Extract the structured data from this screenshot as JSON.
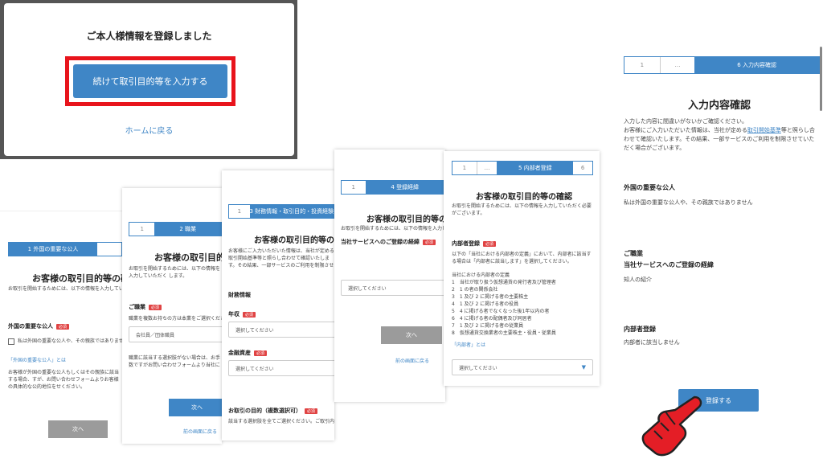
{
  "dialog": {
    "title": "ご本人様情報を登録しました",
    "continue_button": "続けて取引目的等を入力する",
    "home_link": "ホームに戻る"
  },
  "p1": {
    "step_active": "1 外国の重要な公人",
    "title": "お客様の取引目的等の確認",
    "intro": "お取引を開始するためには、以下の情報を入力していただく",
    "pep_label": "外国の重要な公人",
    "checkbox_label": "私は外国の重要な公人や、その親族ではありません",
    "pep_link": "「外国の重要な公人」とは",
    "note": "お客様が外国の重要な公人もしくはその親族に該当する場合、すが、お問い合わせフォームよりお客様の具体的な公的地位をせください。",
    "next_button": "次へ"
  },
  "p2": {
    "step_1": "1",
    "step_active": "2 職業",
    "title": "お客様の取引目的",
    "intro": "お取引を開始するためには、以下の情報を入力していただく します。",
    "occupation_label": "ご職業",
    "occupation_hint": "職業を複数お持ちの方は本業をご選択ください。",
    "occupation_value": "会社員／団体職員",
    "note": "職業に該当する選択肢がない場合は、お手数ですがお問い合わせフォームより当社にお知らせください。",
    "next_button": "次へ",
    "back_link": "前の画面に戻る"
  },
  "p3": {
    "step_1": "1",
    "step_active": "3 財務情報・取引目的・投資経験",
    "title": "お客様の取引目的等の確",
    "intro": "お客様にご入力いただいた情報は、当社が定める取引開始基準等と照らし合わせて確認いたします。その結果、一部サービスのご利用を制限させていただく場合がございます。",
    "section": "財務情報",
    "income_label": "年収",
    "income_placeholder": "選択してください",
    "assets_label": "金融資産",
    "assets_placeholder": "選択してください",
    "purpose_label": "お取引の目的（複数選択可）",
    "purpose_hint": "該当する選択肢を全てご選択ください。ご取引内容に応じてご利用いただ"
  },
  "p4": {
    "step_1": "1",
    "step_active": "4 登録経緯",
    "title": "お客様の取引目的等の確",
    "intro": "お取引を開始するためには、以下の情報を入力していただく",
    "channel_label": "当社サービスへのご登録の経緯",
    "channel_placeholder": "選択してください",
    "next_button": "次へ",
    "back_link": "前の画面に戻る"
  },
  "p5": {
    "step_1": "1",
    "step_2": "…",
    "step_active": "5 内部者登録",
    "step_6": "6",
    "title": "お客様の取引目的等の確認",
    "intro": "お取引を開始するためには、以下の情報を入力していただく必要がございます。",
    "insider_label": "内部者登録",
    "insider_text": "以下の「当社における内部者の定義」において、内部者に該当する場合は「内部者に該当します」を選択してください。",
    "definition_title": "当社における内部者の定義",
    "definitions": [
      "1　当社が取り扱う仮想通貨の発行者及び管理者",
      "2　1 の者の関係会社",
      "3　1 及び 2 に掲げる者の主要株主",
      "4　1 及び 2 に掲げる者の役員",
      "5　4 に掲げる者でなくなった後1年以内の者",
      "6　4 に掲げる者の配偶者及び同居者",
      "7　1 及び 2 に掲げる者の従業員",
      "8　仮想通貨交換業者の主要株主・役員・従業員"
    ],
    "insider_link": "「内部者」とは",
    "select_placeholder": "選択してください"
  },
  "p6": {
    "step_1": "1",
    "step_2": "…",
    "step_active": "6 入力内容確認",
    "title": "入力内容確認",
    "intro1": "入力した内容に間違いがないかご確認ください。",
    "intro2_a": "お客様にご入力いただいた情報は、当社が定める",
    "intro2_link": "取引開始基準",
    "intro2_b": "等と照らし合わせて確認いたします。その結果、一部サービスのご利用を制限させていただく場合がございます。",
    "pep_label": "外国の重要な公人",
    "pep_value": "私は外国の重要な公人や、その親族ではありません",
    "occupation_label": "ご職業",
    "channel_label": "当社サービスへのご登録の経緯",
    "channel_value": "知人の紹介",
    "insider_label": "内部者登録",
    "insider_value": "内部者に該当しません",
    "register_button": "登録する"
  },
  "colors": {
    "accent": "#3f86c6",
    "highlight": "#e8141c",
    "required": "#e04343",
    "hand": "#e41e26"
  }
}
